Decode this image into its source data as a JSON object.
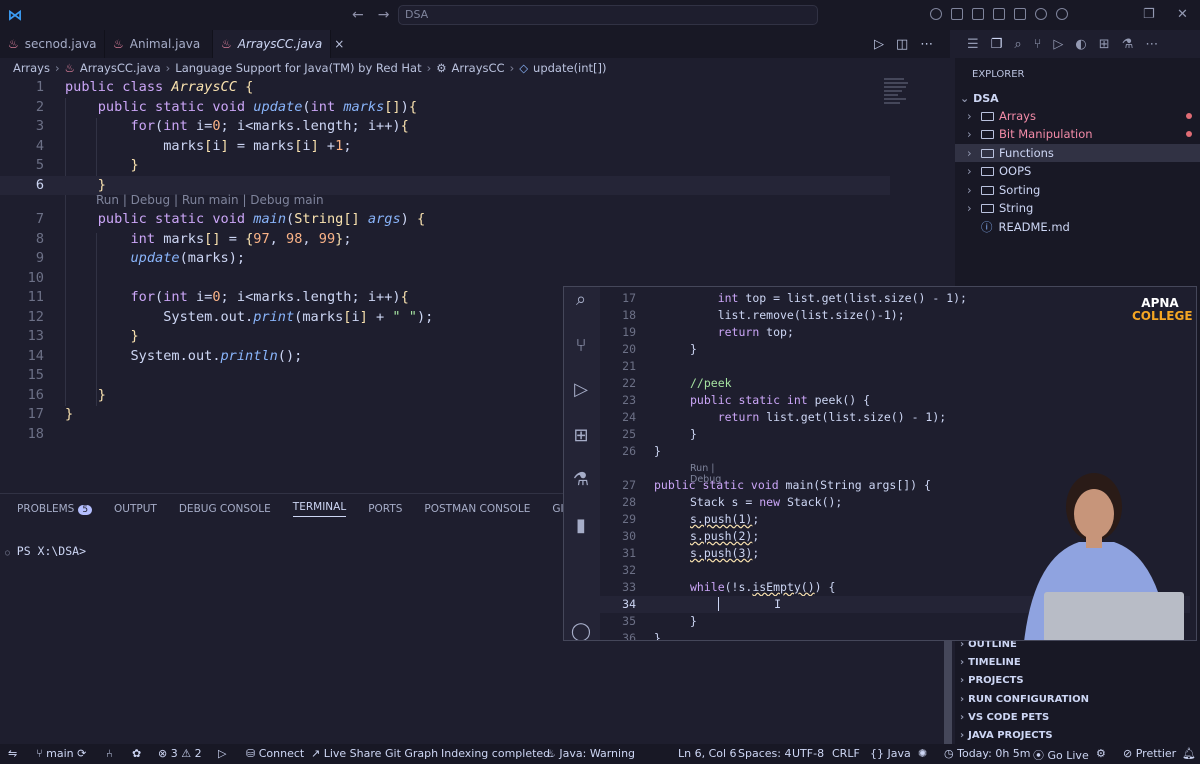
{
  "titlebar": {
    "search_text": "DSA"
  },
  "tabs": [
    {
      "label": "secnod.java",
      "active": false
    },
    {
      "label": "Animal.java",
      "active": false
    },
    {
      "label": "ArraysCC.java",
      "active": true,
      "close": "×"
    }
  ],
  "breadcrumb": {
    "items": [
      "Arrays",
      "ArraysCC.java",
      "Language Support for Java(TM) by Red Hat",
      "ArraysCC",
      "update(int[])"
    ]
  },
  "editor": {
    "codelens": "Run | Debug | Run main | Debug main",
    "line_numbers": [
      "1",
      "2",
      "3",
      "4",
      "5",
      "6",
      "7",
      "8",
      "9",
      "10",
      "11",
      "12",
      "13",
      "14",
      "15",
      "16",
      "17",
      "18"
    ]
  },
  "panel": {
    "tabs": [
      {
        "label": "PROBLEMS",
        "badge": "5"
      },
      {
        "label": "OUTPUT"
      },
      {
        "label": "DEBUG CONSOLE"
      },
      {
        "label": "TERMINAL",
        "active": true
      },
      {
        "label": "PORTS"
      },
      {
        "label": "POSTMAN CONSOLE"
      },
      {
        "label": "GITLENS"
      }
    ],
    "terminal_prompt": "PS X:\\DSA>"
  },
  "explorer": {
    "title": "EXPLORER",
    "root": "DSA",
    "items": [
      {
        "label": "Arrays",
        "type": "folder",
        "modified": true
      },
      {
        "label": "Bit Manipulation",
        "type": "folder",
        "modified": true
      },
      {
        "label": "Functions",
        "type": "folder",
        "selected": true
      },
      {
        "label": "OOPS",
        "type": "folder"
      },
      {
        "label": "Sorting",
        "type": "folder"
      },
      {
        "label": "String",
        "type": "folder"
      },
      {
        "label": "README.md",
        "type": "file"
      }
    ],
    "sections": [
      "OUTLINE",
      "TIMELINE",
      "PROJECTS",
      "RUN CONFIGURATION",
      "VS CODE PETS",
      "JAVA PROJECTS"
    ]
  },
  "video": {
    "brand_line1": "APNA",
    "brand_line2": "COLLEGE",
    "codelens": "Run | Debug",
    "line_numbers": [
      "17",
      "18",
      "19",
      "20",
      "21",
      "22",
      "23",
      "24",
      "25",
      "26",
      "27",
      "28",
      "29",
      "30",
      "31",
      "32",
      "33",
      "34",
      "35",
      "36"
    ]
  },
  "statusbar": {
    "branch": "main",
    "errors": "3",
    "warnings": "2",
    "connect": "Connect",
    "liveshare": "Live Share",
    "gitgraph": "Git Graph",
    "indexing": "Indexing completed.",
    "java_warning": "Java: Warning",
    "position": "Ln 6, Col 6",
    "spaces": "Spaces: 4",
    "encoding": "UTF-8",
    "eol": "CRLF",
    "language": "Java",
    "today": "Today: 0h 5m",
    "golive": "Go Live",
    "prettier": "Prettier"
  }
}
